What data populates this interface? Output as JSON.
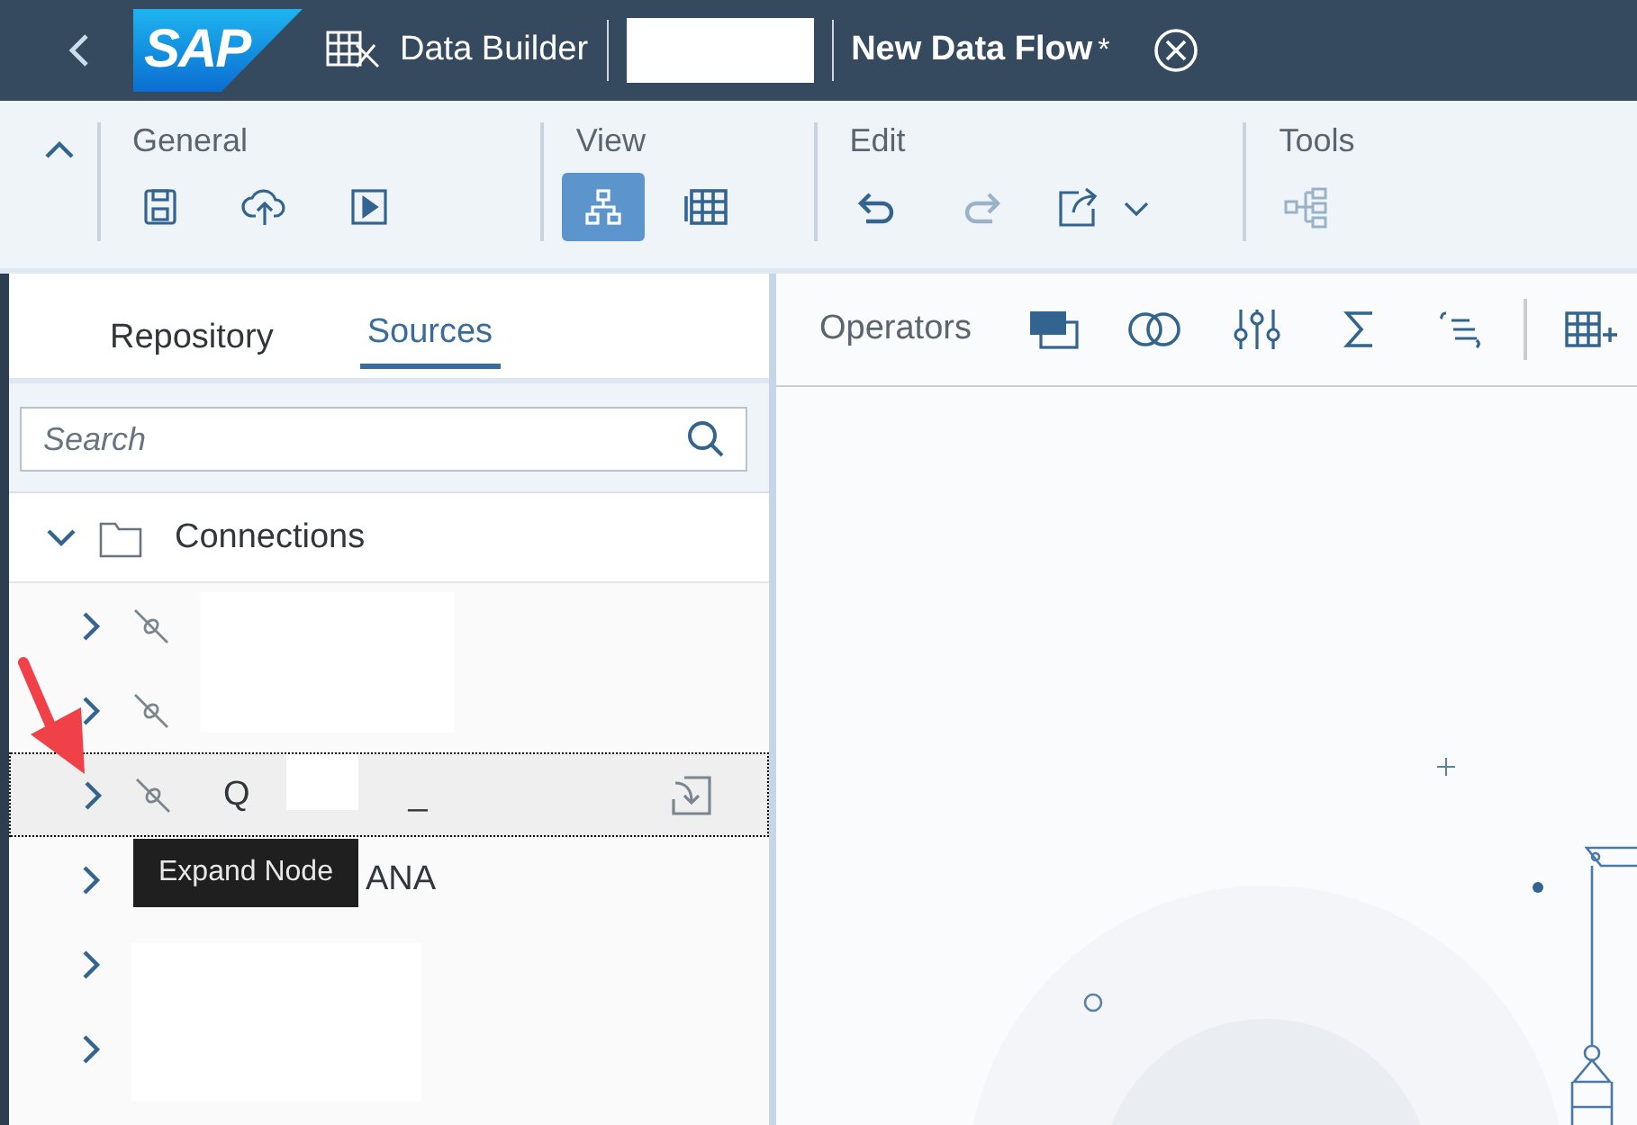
{
  "header": {
    "logo": "SAP",
    "app": "Data Builder",
    "title": "New Data Flow",
    "modified_mark": "*"
  },
  "toolbar": {
    "collapse": true,
    "groups": [
      {
        "label": "General",
        "buttons": [
          {
            "kind": "save",
            "selected": false,
            "disabled": false
          },
          {
            "kind": "deploy",
            "selected": false,
            "disabled": false
          },
          {
            "kind": "run",
            "selected": false,
            "disabled": false
          }
        ]
      },
      {
        "label": "View",
        "buttons": [
          {
            "kind": "diagram",
            "selected": true,
            "disabled": false
          },
          {
            "kind": "table",
            "selected": false,
            "disabled": false
          }
        ]
      },
      {
        "label": "Edit",
        "buttons": [
          {
            "kind": "undo",
            "selected": false,
            "disabled": false
          },
          {
            "kind": "redo",
            "selected": false,
            "disabled": true
          },
          {
            "kind": "export",
            "selected": false,
            "disabled": false
          }
        ]
      },
      {
        "label": "Tools",
        "buttons": [
          {
            "kind": "tree",
            "selected": false,
            "disabled": true
          }
        ]
      }
    ]
  },
  "side_panel": {
    "tabs": [
      {
        "label": "Repository",
        "selected": false
      },
      {
        "label": "Sources",
        "selected": true
      }
    ],
    "search": {
      "placeholder": "Search"
    },
    "tree": {
      "label": "Connections",
      "expanded": true,
      "children": [
        {
          "connection_icon": true,
          "expanded": false,
          "selected": false,
          "import_action": false
        },
        {
          "connection_icon": true,
          "expanded": false,
          "selected": false,
          "import_action": false
        },
        {
          "connection_icon": true,
          "label": "Q",
          "label_end": "_",
          "expanded": false,
          "selected": true,
          "import_action": true
        },
        {
          "connection_icon": false,
          "label": "ANA",
          "expanded": false,
          "selected": false,
          "import_action": false
        },
        {
          "connection_icon": false,
          "expanded": false,
          "selected": false,
          "import_action": false
        },
        {
          "connection_icon": false,
          "expanded": false,
          "selected": false,
          "import_action": false
        }
      ]
    },
    "tooltip": "Expand Node"
  },
  "canvas": {
    "operators_label": "Operators",
    "operators": [
      {
        "kind": "projection"
      },
      {
        "kind": "join"
      },
      {
        "kind": "filter"
      },
      {
        "kind": "aggregation"
      },
      {
        "kind": "script"
      },
      {
        "kind": "add-table"
      }
    ]
  }
}
